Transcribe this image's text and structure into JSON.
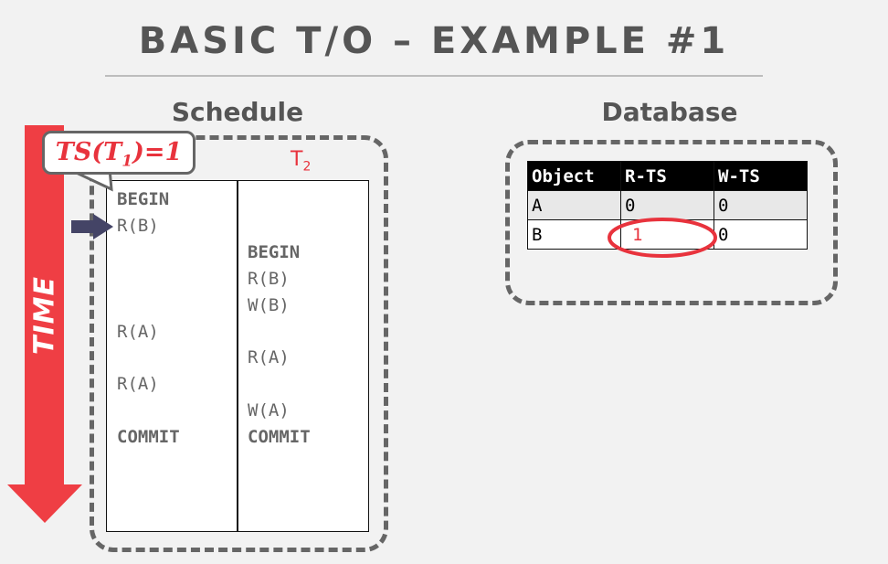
{
  "title": "BASIC T/O – EXAMPLE #1",
  "schedule": {
    "heading": "Schedule",
    "time_label": "TIME",
    "timestamp_callout": {
      "prefix": "TS(T",
      "sub": "1",
      "suffix": ")=1"
    },
    "t2_label": {
      "main": "T",
      "sub": "2"
    },
    "t1_ops": [
      {
        "text": "BEGIN",
        "bold": true
      },
      {
        "text": "R(B)"
      },
      {
        "text": "R(A)"
      },
      {
        "text": "R(A)"
      },
      {
        "text": "COMMIT",
        "bold": true
      }
    ],
    "t2_ops": [
      {
        "text": "BEGIN",
        "bold": true
      },
      {
        "text": "R(B)"
      },
      {
        "text": "W(B)"
      },
      {
        "text": "R(A)"
      },
      {
        "text": "W(A)"
      },
      {
        "text": "COMMIT",
        "bold": true
      }
    ],
    "current_step": "R(B)"
  },
  "database": {
    "heading": "Database",
    "columns": [
      "Object",
      "R-TS",
      "W-TS"
    ],
    "rows": [
      [
        "A",
        "0",
        "0"
      ],
      [
        "B",
        "1",
        "0"
      ]
    ],
    "highlighted_cell": "B R-TS"
  },
  "colors": {
    "accent": "#e8333d",
    "arrow": "#444466",
    "text": "#555555"
  }
}
